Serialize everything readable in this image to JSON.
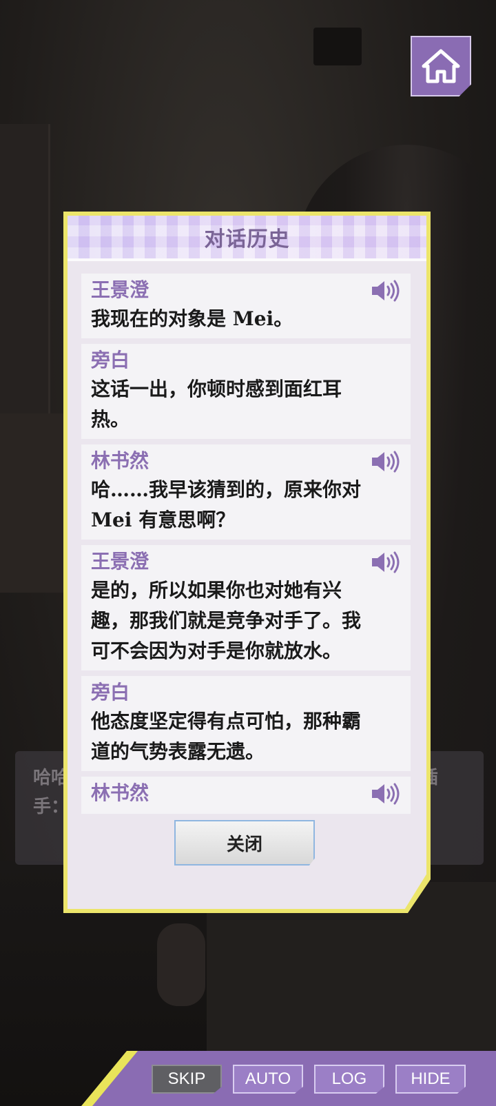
{
  "home": {
    "icon": "home-icon"
  },
  "background_dialog": {
    "left_text": "哈哈\n手：",
    "right_text": "插"
  },
  "log_panel": {
    "title": "对话历史",
    "entries": [
      {
        "speaker": "王景澄",
        "text": "我现在的对象是 Mei。",
        "voice": true
      },
      {
        "speaker": "旁白",
        "text": "这话一出，你顿时感到面红耳热。",
        "voice": false
      },
      {
        "speaker": "林书然",
        "text": "哈……我早该猜到的，原来你对 Mei 有意思啊？",
        "voice": true
      },
      {
        "speaker": "王景澄",
        "text": "是的，所以如果你也对她有兴趣，那我们就是竞争对手了。我可不会因为对手是你就放水。",
        "voice": true
      },
      {
        "speaker": "旁白",
        "text": "他态度坚定得有点可怕，那种霸道的气势表露无遗。",
        "voice": false
      },
      {
        "speaker": "林书然",
        "text": "",
        "voice": true
      }
    ],
    "close_label": "关闭"
  },
  "bottom_bar": {
    "skip_label": "SKIP",
    "auto_label": "AUTO",
    "log_label": "LOG",
    "hide_label": "HIDE"
  },
  "colors": {
    "accent_purple": "#8a6cb3",
    "highlight_yellow": "#e9e45a",
    "speaker_color": "#8b6fb2"
  }
}
